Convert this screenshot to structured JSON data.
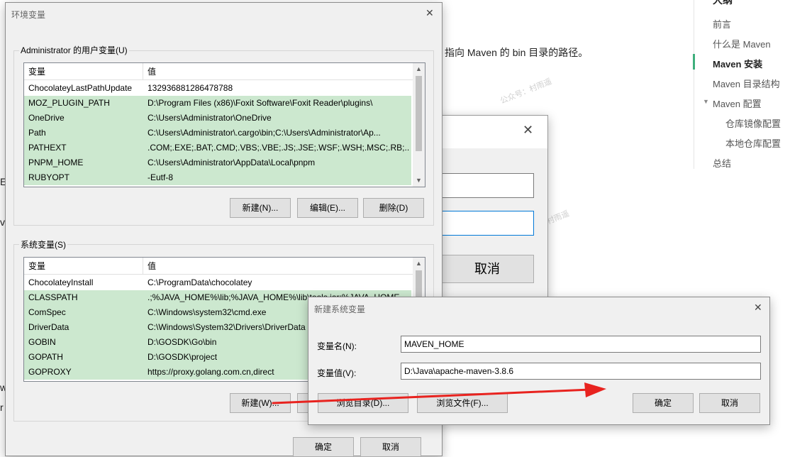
{
  "article": {
    "heading_fragment": "大纲",
    "text_fragment": "指向 Maven 的 bin 目录的路径。",
    "left_glyphs": [
      "E",
      "v",
      "w",
      "r"
    ],
    "watermarks": [
      "公众号：村雨遥",
      "村雨遥"
    ]
  },
  "toc": {
    "items": [
      {
        "label": "前言",
        "active": false,
        "indent": 0
      },
      {
        "label": "什么是 Maven",
        "active": false,
        "indent": 0
      },
      {
        "label": "Maven 安装",
        "active": true,
        "indent": 0
      },
      {
        "label": "Maven 目录结构",
        "active": false,
        "indent": 0
      },
      {
        "label": "Maven 配置",
        "active": false,
        "indent": 0,
        "expander": "▼"
      },
      {
        "label": "仓库镜像配置",
        "active": false,
        "indent": 1
      },
      {
        "label": "本地仓库配置",
        "active": false,
        "indent": 1
      },
      {
        "label": "总结",
        "active": false,
        "indent": 0
      }
    ]
  },
  "edit_var_dialog": {
    "close": "✕",
    "cancel_label": "取消"
  },
  "env_dialog": {
    "title": "环境变量",
    "close": "✕",
    "user_group_label": "Administrator 的用户变量(U)",
    "system_group_label": "系统变量(S)",
    "col_name": "变量",
    "col_value": "值",
    "user_vars": [
      {
        "name": "ChocolateyLastPathUpdate",
        "value": "132936881286478788",
        "selected": false
      },
      {
        "name": "MOZ_PLUGIN_PATH",
        "value": "D:\\Program Files (x86)\\Foxit Software\\Foxit Reader\\plugins\\",
        "selected": true
      },
      {
        "name": "OneDrive",
        "value": "C:\\Users\\Administrator\\OneDrive",
        "selected": true
      },
      {
        "name": "Path",
        "value": "C:\\Users\\Administrator\\.cargo\\bin;C:\\Users\\Administrator\\Ap...",
        "selected": true
      },
      {
        "name": "PATHEXT",
        "value": ".COM;.EXE;.BAT;.CMD;.VBS;.VBE;.JS;.JSE;.WSF;.WSH;.MSC;.RB;....",
        "selected": true
      },
      {
        "name": "PNPM_HOME",
        "value": "C:\\Users\\Administrator\\AppData\\Local\\pnpm",
        "selected": true
      },
      {
        "name": "RUBYOPT",
        "value": "-Eutf-8",
        "selected": true
      }
    ],
    "system_vars": [
      {
        "name": "ChocolateyInstall",
        "value": "C:\\ProgramData\\chocolatey",
        "selected": false
      },
      {
        "name": "CLASSPATH",
        "value": ".;%JAVA_HOME%\\lib;%JAVA_HOME%\\lib\\tools.jar;%JAVA_HOME...",
        "selected": true
      },
      {
        "name": "ComSpec",
        "value": "C:\\Windows\\system32\\cmd.exe",
        "selected": true
      },
      {
        "name": "DriverData",
        "value": "C:\\Windows\\System32\\Drivers\\DriverData",
        "selected": true
      },
      {
        "name": "GOBIN",
        "value": "D:\\GOSDK\\Go\\bin",
        "selected": true
      },
      {
        "name": "GOPATH",
        "value": "D:\\GOSDK\\project",
        "selected": true
      },
      {
        "name": "GOPROXY",
        "value": "https://proxy.golang.com.cn,direct",
        "selected": true
      }
    ],
    "user_buttons": {
      "new": "新建(N)...",
      "edit": "编辑(E)...",
      "delete": "删除(D)"
    },
    "system_buttons": {
      "new": "新建(W)..."
    },
    "ok_label": "确定",
    "cancel_label": "取消"
  },
  "new_var_dialog": {
    "title": "新建系统变量",
    "close": "✕",
    "name_label": "变量名(N):",
    "name_value": "MAVEN_HOME",
    "value_label": "变量值(V):",
    "value_value": "D:\\Java\\apache-maven-3.8.6",
    "browse_dir_label": "浏览目录(D)...",
    "browse_file_label": "浏览文件(F)...",
    "ok_label": "确定",
    "cancel_label": "取消"
  },
  "colors": {
    "selection": "#cce8cf",
    "annotation_arrow": "#e8231f",
    "toc_accent": "#3eaf7c"
  }
}
